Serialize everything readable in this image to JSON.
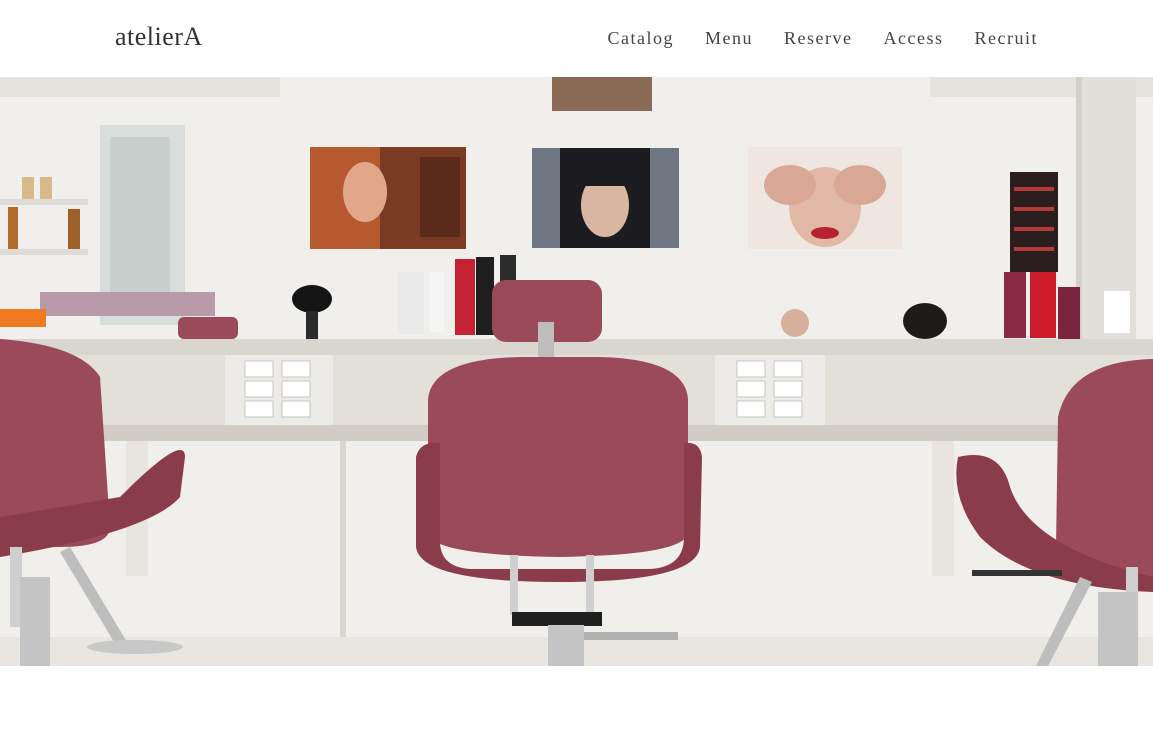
{
  "header": {
    "logo": "atelierA",
    "nav": [
      {
        "label": "Catalog"
      },
      {
        "label": "Menu"
      },
      {
        "label": "Reserve"
      },
      {
        "label": "Access"
      },
      {
        "label": "Recruit"
      }
    ]
  },
  "hero": {
    "image": "salon-interior-photo",
    "colors": {
      "chair": "#9b4a5a",
      "wall": "#f2f0ec",
      "counter": "#dcd8d2"
    }
  }
}
